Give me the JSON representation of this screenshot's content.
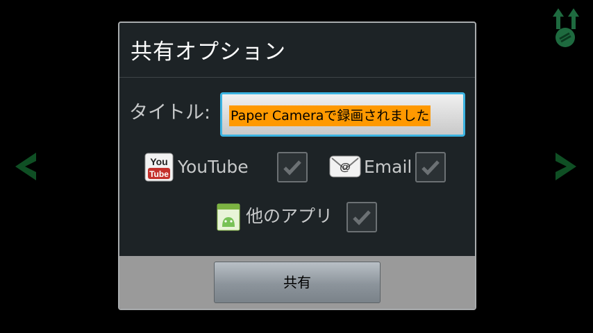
{
  "dialog": {
    "title": "共有オプション",
    "title_field": {
      "label": "タイトル:",
      "value": "Paper Cameraで録画されました"
    },
    "options": [
      {
        "label": "YouTube",
        "icon": "youtube-icon",
        "checked": true
      },
      {
        "label": "Email",
        "icon": "email-icon",
        "checked": true
      },
      {
        "label": "他のアプリ",
        "icon": "android-app-icon",
        "checked": true
      }
    ],
    "share_button_label": "共有",
    "youtube_logo_top": "You",
    "youtube_logo_bottom": "Tube"
  },
  "colors": {
    "accent_border": "#3cb3e0",
    "highlight": "#ff9900",
    "nav_arrow": "#0f4f24"
  }
}
